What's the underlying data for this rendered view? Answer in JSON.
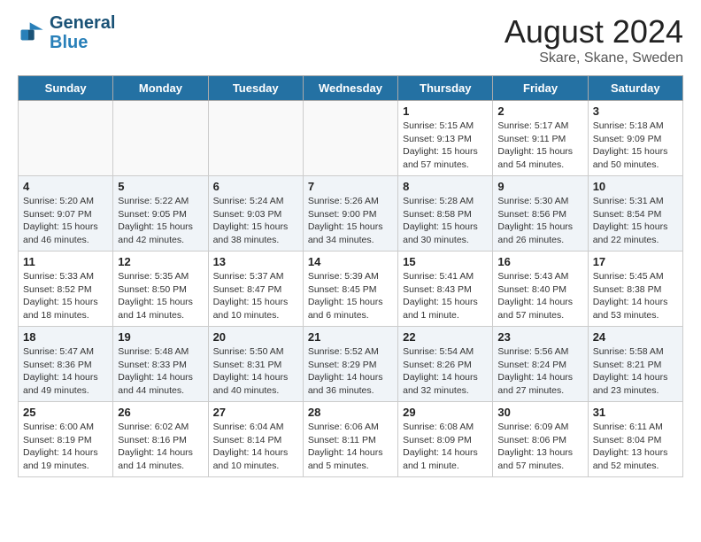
{
  "header": {
    "logo_line1": "General",
    "logo_line2": "Blue",
    "month_title": "August 2024",
    "location": "Skare, Skane, Sweden"
  },
  "days_of_week": [
    "Sunday",
    "Monday",
    "Tuesday",
    "Wednesday",
    "Thursday",
    "Friday",
    "Saturday"
  ],
  "weeks": [
    [
      {
        "day": "",
        "info": ""
      },
      {
        "day": "",
        "info": ""
      },
      {
        "day": "",
        "info": ""
      },
      {
        "day": "",
        "info": ""
      },
      {
        "day": "1",
        "info": "Sunrise: 5:15 AM\nSunset: 9:13 PM\nDaylight: 15 hours\nand 57 minutes."
      },
      {
        "day": "2",
        "info": "Sunrise: 5:17 AM\nSunset: 9:11 PM\nDaylight: 15 hours\nand 54 minutes."
      },
      {
        "day": "3",
        "info": "Sunrise: 5:18 AM\nSunset: 9:09 PM\nDaylight: 15 hours\nand 50 minutes."
      }
    ],
    [
      {
        "day": "4",
        "info": "Sunrise: 5:20 AM\nSunset: 9:07 PM\nDaylight: 15 hours\nand 46 minutes."
      },
      {
        "day": "5",
        "info": "Sunrise: 5:22 AM\nSunset: 9:05 PM\nDaylight: 15 hours\nand 42 minutes."
      },
      {
        "day": "6",
        "info": "Sunrise: 5:24 AM\nSunset: 9:03 PM\nDaylight: 15 hours\nand 38 minutes."
      },
      {
        "day": "7",
        "info": "Sunrise: 5:26 AM\nSunset: 9:00 PM\nDaylight: 15 hours\nand 34 minutes."
      },
      {
        "day": "8",
        "info": "Sunrise: 5:28 AM\nSunset: 8:58 PM\nDaylight: 15 hours\nand 30 minutes."
      },
      {
        "day": "9",
        "info": "Sunrise: 5:30 AM\nSunset: 8:56 PM\nDaylight: 15 hours\nand 26 minutes."
      },
      {
        "day": "10",
        "info": "Sunrise: 5:31 AM\nSunset: 8:54 PM\nDaylight: 15 hours\nand 22 minutes."
      }
    ],
    [
      {
        "day": "11",
        "info": "Sunrise: 5:33 AM\nSunset: 8:52 PM\nDaylight: 15 hours\nand 18 minutes."
      },
      {
        "day": "12",
        "info": "Sunrise: 5:35 AM\nSunset: 8:50 PM\nDaylight: 15 hours\nand 14 minutes."
      },
      {
        "day": "13",
        "info": "Sunrise: 5:37 AM\nSunset: 8:47 PM\nDaylight: 15 hours\nand 10 minutes."
      },
      {
        "day": "14",
        "info": "Sunrise: 5:39 AM\nSunset: 8:45 PM\nDaylight: 15 hours\nand 6 minutes."
      },
      {
        "day": "15",
        "info": "Sunrise: 5:41 AM\nSunset: 8:43 PM\nDaylight: 15 hours\nand 1 minute."
      },
      {
        "day": "16",
        "info": "Sunrise: 5:43 AM\nSunset: 8:40 PM\nDaylight: 14 hours\nand 57 minutes."
      },
      {
        "day": "17",
        "info": "Sunrise: 5:45 AM\nSunset: 8:38 PM\nDaylight: 14 hours\nand 53 minutes."
      }
    ],
    [
      {
        "day": "18",
        "info": "Sunrise: 5:47 AM\nSunset: 8:36 PM\nDaylight: 14 hours\nand 49 minutes."
      },
      {
        "day": "19",
        "info": "Sunrise: 5:48 AM\nSunset: 8:33 PM\nDaylight: 14 hours\nand 44 minutes."
      },
      {
        "day": "20",
        "info": "Sunrise: 5:50 AM\nSunset: 8:31 PM\nDaylight: 14 hours\nand 40 minutes."
      },
      {
        "day": "21",
        "info": "Sunrise: 5:52 AM\nSunset: 8:29 PM\nDaylight: 14 hours\nand 36 minutes."
      },
      {
        "day": "22",
        "info": "Sunrise: 5:54 AM\nSunset: 8:26 PM\nDaylight: 14 hours\nand 32 minutes."
      },
      {
        "day": "23",
        "info": "Sunrise: 5:56 AM\nSunset: 8:24 PM\nDaylight: 14 hours\nand 27 minutes."
      },
      {
        "day": "24",
        "info": "Sunrise: 5:58 AM\nSunset: 8:21 PM\nDaylight: 14 hours\nand 23 minutes."
      }
    ],
    [
      {
        "day": "25",
        "info": "Sunrise: 6:00 AM\nSunset: 8:19 PM\nDaylight: 14 hours\nand 19 minutes."
      },
      {
        "day": "26",
        "info": "Sunrise: 6:02 AM\nSunset: 8:16 PM\nDaylight: 14 hours\nand 14 minutes."
      },
      {
        "day": "27",
        "info": "Sunrise: 6:04 AM\nSunset: 8:14 PM\nDaylight: 14 hours\nand 10 minutes."
      },
      {
        "day": "28",
        "info": "Sunrise: 6:06 AM\nSunset: 8:11 PM\nDaylight: 14 hours\nand 5 minutes."
      },
      {
        "day": "29",
        "info": "Sunrise: 6:08 AM\nSunset: 8:09 PM\nDaylight: 14 hours\nand 1 minute."
      },
      {
        "day": "30",
        "info": "Sunrise: 6:09 AM\nSunset: 8:06 PM\nDaylight: 13 hours\nand 57 minutes."
      },
      {
        "day": "31",
        "info": "Sunrise: 6:11 AM\nSunset: 8:04 PM\nDaylight: 13 hours\nand 52 minutes."
      }
    ]
  ]
}
